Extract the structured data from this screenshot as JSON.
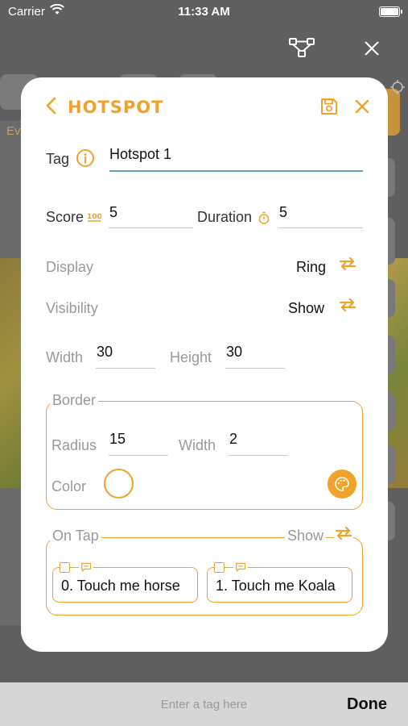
{
  "status": {
    "carrier": "Carrier",
    "time": "11:33 AM"
  },
  "background": {
    "side_label": "Ev"
  },
  "modal": {
    "title": "HOTSPOT",
    "tag": {
      "label": "Tag",
      "value": "Hotspot 1"
    },
    "score": {
      "label": "Score",
      "value": "5"
    },
    "duration": {
      "label": "Duration",
      "value": "5"
    },
    "display": {
      "label": "Display",
      "value": "Ring"
    },
    "visibility": {
      "label": "Visibility",
      "value": "Show"
    },
    "width": {
      "label": "Width",
      "value": "30"
    },
    "height": {
      "label": "Height",
      "value": "30"
    },
    "border": {
      "legend": "Border",
      "radius": {
        "label": "Radius",
        "value": "15"
      },
      "width": {
        "label": "Width",
        "value": "2"
      },
      "color_label": "Color"
    },
    "ontap": {
      "legend": "On Tap",
      "mode": "Show",
      "items": [
        "0. Touch me horse",
        "1. Touch me Koala"
      ]
    }
  },
  "keyboard_bar": {
    "placeholder": "Enter a tag here",
    "done": "Done"
  },
  "colors": {
    "accent": "#f0a32a",
    "active_underline": "#5ea9b6",
    "border_color_swatch": "#ffffff"
  }
}
